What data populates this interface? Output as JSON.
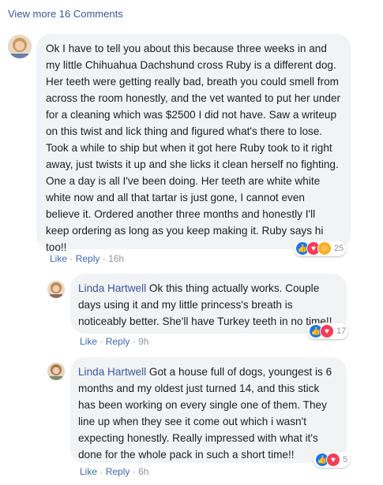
{
  "view_more": "View more 16 Comments",
  "comments": [
    {
      "name": "",
      "text": "Ok I have to tell you about this because three weeks in and my little Chihuahua Dachshund cross Ruby is a different dog. Her teeth were getting really bad, breath you could smell from across the room honestly, and the vet wanted to put her under for a cleaning which was $2500 I did not have. Saw a writeup on this twist and lick thing and figured what's there to lose. Took a while to ship but when it got here Ruby took to it right away, just twists it up and she licks it clean herself no fighting. One a day is all I've been doing. Her teeth are white white white now and all that tartar is just gone, I cannot even believe it. Ordered another three months and honestly I'll keep ordering as long as you keep making it. Ruby says hi too!!",
      "like": "Like",
      "reply": "Reply",
      "time": "16h",
      "reaction_count": "25",
      "reactions": [
        "like",
        "love",
        "haha"
      ]
    },
    {
      "name": "Linda Hartwell",
      "text": "Ok this thing actually works. Couple days using it and my little princess's breath is noticeably better. She'll have Turkey teeth in no time!!",
      "like": "Like",
      "reply": "Reply",
      "time": "9h",
      "reaction_count": "17",
      "reactions": [
        "like",
        "love"
      ]
    },
    {
      "name": "Linda Hartwell",
      "text": "Got a house full of dogs, youngest is 6 months and my oldest just turned 14, and this stick has been working on every single one of them. They line up when they see it come out which i wasn't expecting honestly. Really impressed with what it's done for the whole pack in such a short time!!",
      "like": "Like",
      "reply": "Reply",
      "time": "6h",
      "reaction_count": "5",
      "reactions": [
        "like",
        "love"
      ]
    }
  ],
  "separator": "·",
  "colors": {
    "link": "#385898",
    "action": "#4267b2",
    "bubble": "#f2f3f5"
  }
}
